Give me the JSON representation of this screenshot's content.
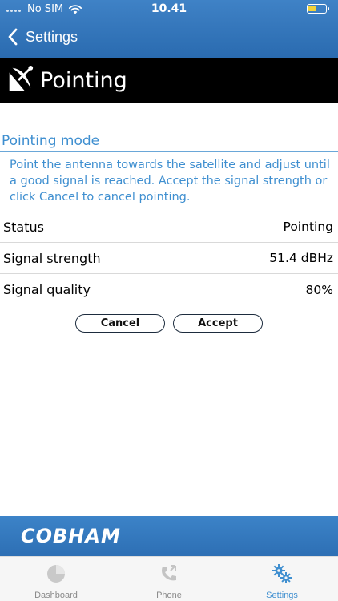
{
  "status_bar": {
    "carrier": "No SIM",
    "time": "10.41"
  },
  "nav": {
    "back_label": "Settings"
  },
  "header": {
    "title": "Pointing",
    "icon": "satellite-dish-icon"
  },
  "section": {
    "title": "Pointing mode",
    "description": "Point the antenna towards the satellite and adjust until a good signal is reached. Accept the signal strength or click Cancel to cancel pointing."
  },
  "rows": [
    {
      "label": "Status",
      "value": "Pointing"
    },
    {
      "label": "Signal strength",
      "value": "51.4 dBHz"
    },
    {
      "label": "Signal quality",
      "value": "80%"
    }
  ],
  "buttons": {
    "cancel": "Cancel",
    "accept": "Accept"
  },
  "brand": {
    "logo_text": "COBHAM"
  },
  "tabs": [
    {
      "label": "Dashboard",
      "icon": "pie-chart-icon",
      "active": false
    },
    {
      "label": "Phone",
      "icon": "phone-icon",
      "active": false
    },
    {
      "label": "Settings",
      "icon": "settings-gears-icon",
      "active": true
    }
  ],
  "colors": {
    "accent": "#3f8fd0",
    "nav_blue": "#3478c0",
    "header_black": "#000000",
    "battery": "#f2d23b"
  }
}
